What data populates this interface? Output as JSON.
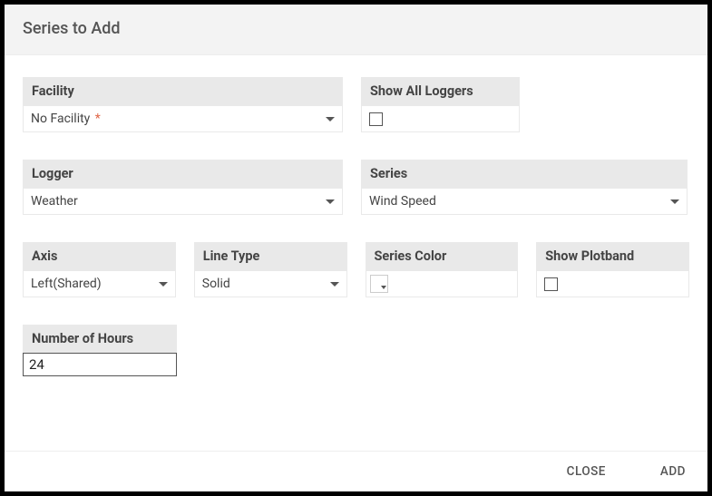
{
  "header": {
    "title": "Series to Add"
  },
  "fields": {
    "facility": {
      "label": "Facility",
      "value": "No Facility",
      "required": true
    },
    "showAll": {
      "label": "Show All Loggers",
      "checked": false
    },
    "logger": {
      "label": "Logger",
      "value": "Weather"
    },
    "series": {
      "label": "Series",
      "value": "Wind Speed"
    },
    "axis": {
      "label": "Axis",
      "value": "Left(Shared)"
    },
    "lineType": {
      "label": "Line Type",
      "value": "Solid"
    },
    "seriesColor": {
      "label": "Series Color"
    },
    "plotband": {
      "label": "Show Plotband",
      "checked": false
    },
    "hours": {
      "label": "Number of Hours",
      "value": "24"
    }
  },
  "footer": {
    "close": "CLOSE",
    "add": "ADD"
  }
}
